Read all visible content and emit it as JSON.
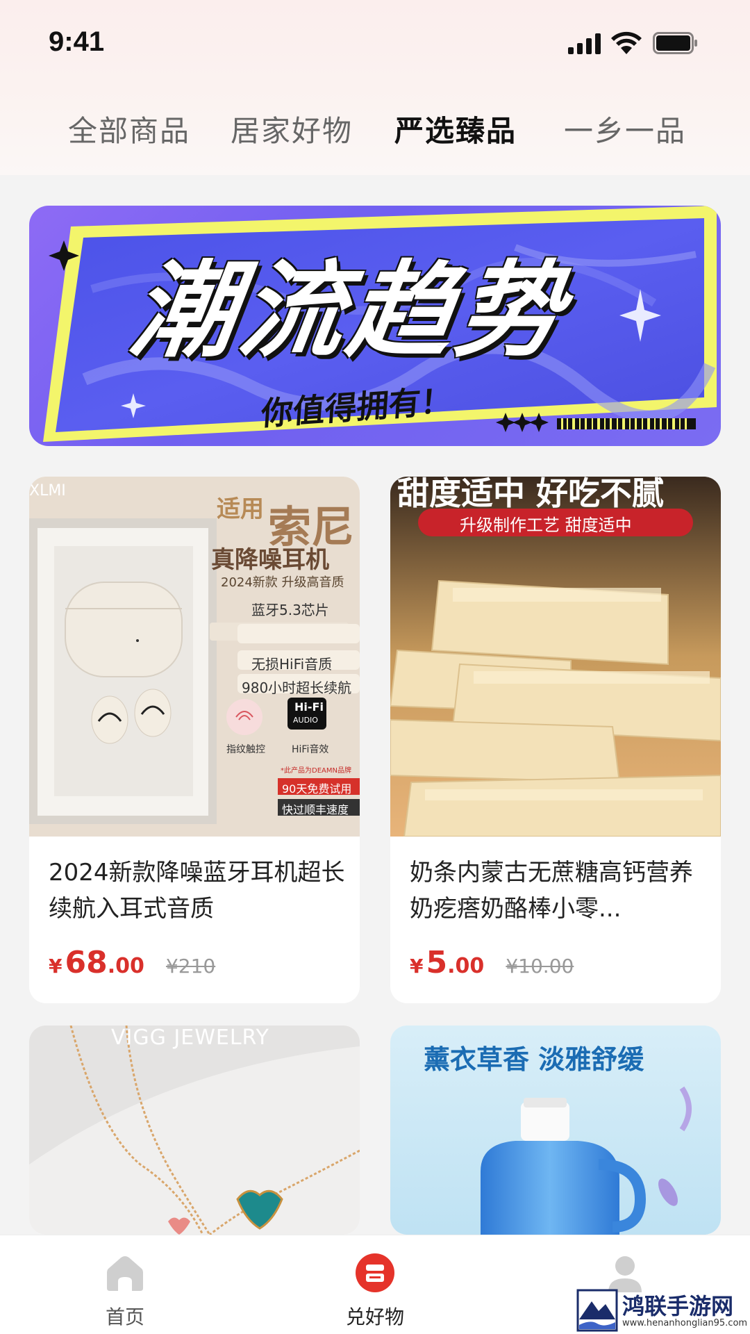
{
  "status_bar": {
    "time": "9:41"
  },
  "tabs": [
    {
      "label": "全部商品",
      "active": false
    },
    {
      "label": "居家好物",
      "active": false
    },
    {
      "label": "严选臻品",
      "active": true
    },
    {
      "label": "一乡一品",
      "active": false
    }
  ],
  "banner": {
    "title": "潮流趋势",
    "subtitle": "你值得拥有！"
  },
  "products": [
    {
      "title": "2024新款降噪蓝牙耳机超长续航入耳式音质",
      "currency": "¥",
      "price_int": "68",
      "price_dec": ".00",
      "original_price": "¥210",
      "image_text": {
        "brand": "XLMI",
        "tag1": "适用",
        "tag2": "索尼",
        "line1": "真降噪耳机",
        "line2": "2024新款 升级高音质",
        "f1": "蓝牙5.3芯片",
        "f2": "无损HiFi音质",
        "f3": "980小时超长续航",
        "icon1": "指纹触控",
        "icon2": "HiFi音效",
        "hifi": "Hi-Fi",
        "audio": "AUDIO",
        "promo1": "90天免费试用",
        "promo2": "快过顺丰速度",
        "note": "*此产品为DEAMN品牌"
      }
    },
    {
      "title": "奶条内蒙古无蔗糖高钙营养奶疙瘩奶酪棒小零...",
      "currency": "¥",
      "price_int": "5",
      "price_dec": ".00",
      "original_price": "¥10.00",
      "image_text": {
        "headline": "甜度适中 好吃不腻",
        "ribbon": "升级制作工艺 甜度适中"
      }
    },
    {
      "image_text": {
        "brand": "VIGG JEWELRY"
      }
    },
    {
      "image_text": {
        "headline": "薰衣草香 淡雅舒缓"
      }
    }
  ],
  "bottom_nav": [
    {
      "label": "首页",
      "active": false
    },
    {
      "label": "兑好物",
      "active": true
    },
    {
      "label": "",
      "active": false
    }
  ],
  "watermark": {
    "name": "鸿联手游网",
    "url": "www.henanhonglian95.com"
  },
  "colors": {
    "accent": "#d9302b",
    "banner_purple": "#6f5ff0",
    "banner_yellow": "#f3f56b"
  }
}
